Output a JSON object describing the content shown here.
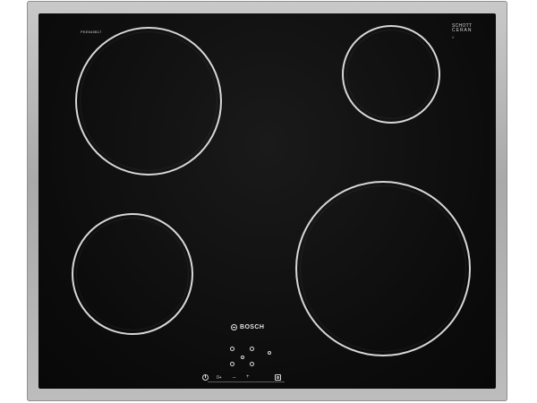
{
  "image": {
    "subject": "ceramic glass cooktop with stainless steel frame",
    "model_label": "PKE645B17",
    "brand_label": "BOSCH",
    "glass_label": {
      "line1": "SCHOTT",
      "line2": "CERAN",
      "line3": "®"
    },
    "controls": {
      "minus_label": "–",
      "plus_label": "+",
      "lock_label": "0+"
    },
    "colors": {
      "glass": "#0c0c0c",
      "frame": "#b3b3b3",
      "zone_ring": "#d8d8d8"
    }
  }
}
